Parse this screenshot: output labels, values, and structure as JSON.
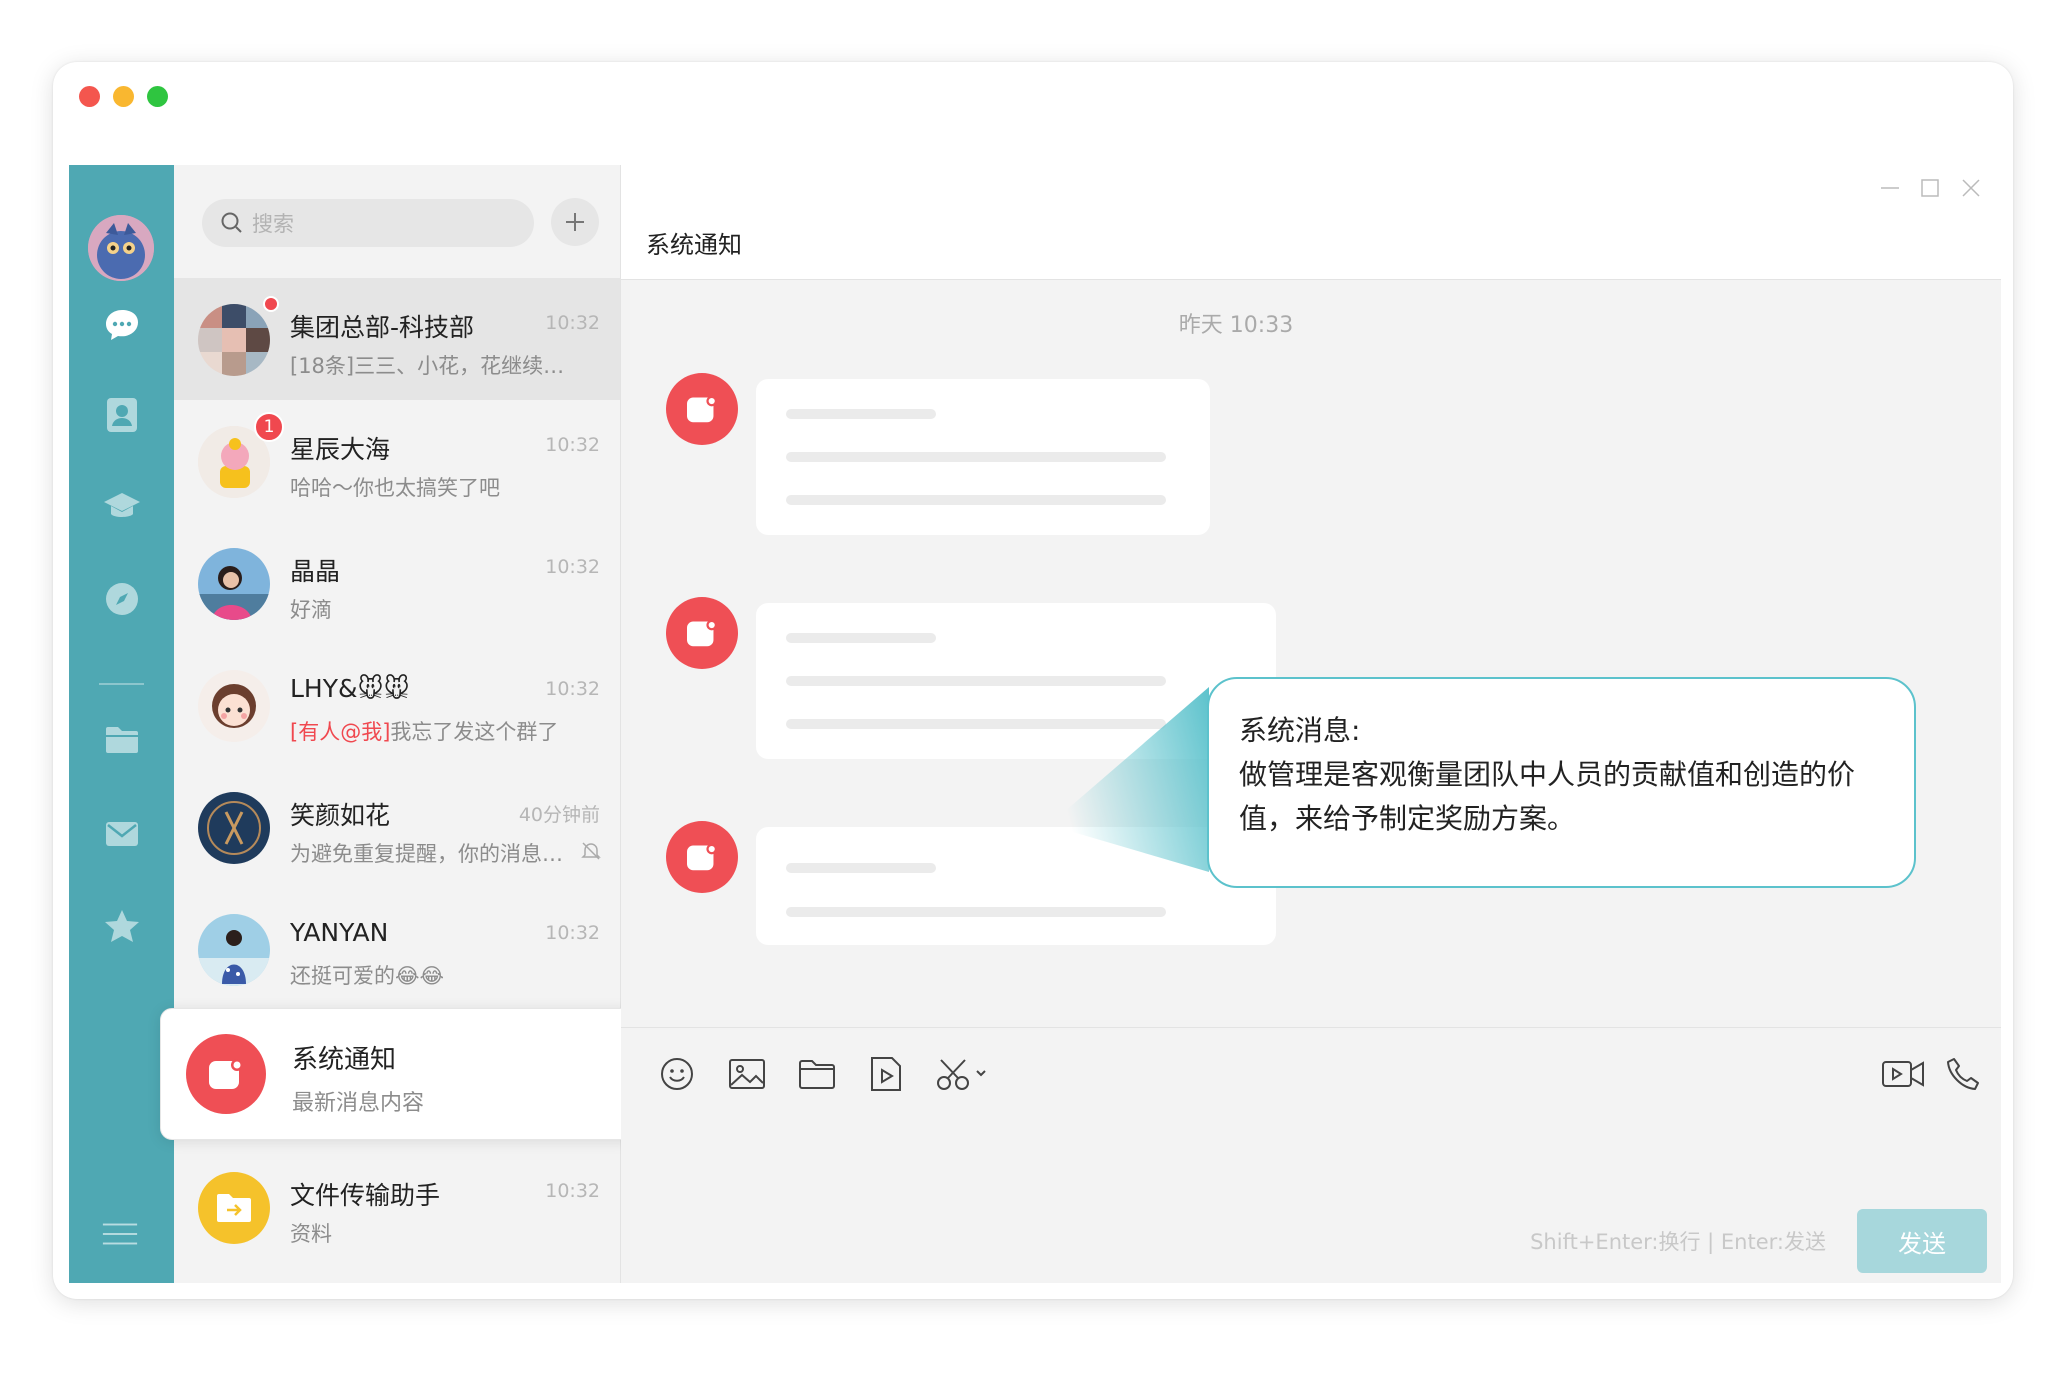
{
  "window": {
    "traffic_lights": [
      "#f4564e",
      "#f9b730",
      "#2fc540"
    ]
  },
  "rail": {
    "items": [
      {
        "name": "chat-icon"
      },
      {
        "name": "contacts-icon"
      },
      {
        "name": "learning-icon"
      },
      {
        "name": "discover-icon"
      },
      {
        "name": "folder-icon"
      },
      {
        "name": "mail-icon"
      },
      {
        "name": "star-icon"
      },
      {
        "name": "menu-icon"
      }
    ],
    "color": "#4fa8b3"
  },
  "search": {
    "placeholder": "搜索"
  },
  "conversations": [
    {
      "name": "集团总部-科技部",
      "time": "10:32",
      "preview": "[18条]三三、小花，花继续…"
    },
    {
      "name": "星辰大海",
      "time": "10:32",
      "preview": "哈哈～你也太搞笑了吧",
      "unread": "1"
    },
    {
      "name": "晶晶",
      "time": "10:32",
      "preview": "好滴"
    },
    {
      "name": "LHY&🐭🐭",
      "time": "10:32",
      "mention": "[有人@我]",
      "preview": "我忘了发这个群了"
    },
    {
      "name": "笑颜如花",
      "time": "40分钟前",
      "preview": "为避免重复提醒，你的消息…"
    },
    {
      "name": "YANYAN",
      "time": "10:32",
      "preview": "还挺可爱的😂😂"
    },
    {
      "name": "系统通知",
      "preview": "最新消息内容"
    },
    {
      "name": "文件传输助手",
      "time": "10:32",
      "preview": "资料"
    }
  ],
  "chat": {
    "title": "系统通知",
    "timestamp": "昨天 10:33",
    "callout_title": "系统消息:",
    "callout_body": "做管理是客观衡量团队中人员的贡献值和创造的价值，来给予制定奖励方案。"
  },
  "toolbar": {
    "hint": "Shift+Enter:换行 | Enter:发送",
    "send_label": "发送",
    "tools": [
      "emoji-icon",
      "image-icon",
      "file-icon",
      "video-file-icon",
      "screenshot-icon",
      "video-call-icon",
      "phone-icon"
    ]
  },
  "colors": {
    "accent": "#4fa8b3",
    "badge": "#f0484f",
    "system": "#ef4f55",
    "file_helper": "#f5c22b",
    "send_disabled": "#a7d7dc",
    "callout_border": "#5cc2cc"
  }
}
